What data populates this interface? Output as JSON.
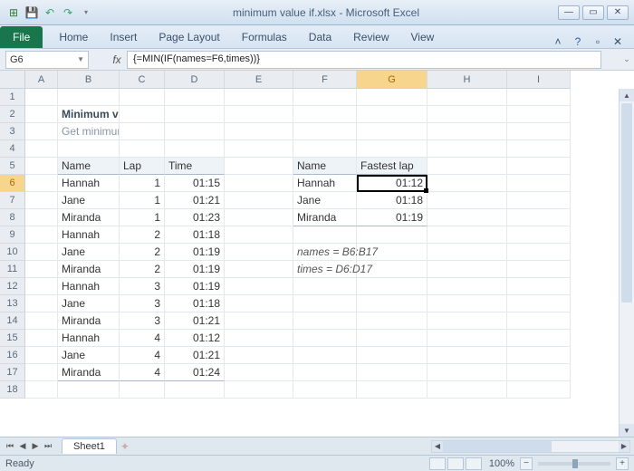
{
  "title": "minimum value if.xlsx  -  Microsoft Excel",
  "tabs": [
    "Home",
    "Insert",
    "Page Layout",
    "Formulas",
    "Data",
    "Review",
    "View"
  ],
  "file_label": "File",
  "namebox": "G6",
  "fx_label": "fx",
  "formula": "{=MIN(IF(names=F6,times))}",
  "columns": [
    "A",
    "B",
    "C",
    "D",
    "E",
    "F",
    "G",
    "H",
    "I"
  ],
  "content": {
    "title": "Minimum value if",
    "subtitle": "Get minimum if criteria matches",
    "table1_headers": [
      "Name",
      "Lap",
      "Time"
    ],
    "table1": [
      [
        "Hannah",
        "1",
        "01:15"
      ],
      [
        "Jane",
        "1",
        "01:21"
      ],
      [
        "Miranda",
        "1",
        "01:23"
      ],
      [
        "Hannah",
        "2",
        "01:18"
      ],
      [
        "Jane",
        "2",
        "01:19"
      ],
      [
        "Miranda",
        "2",
        "01:19"
      ],
      [
        "Hannah",
        "3",
        "01:19"
      ],
      [
        "Jane",
        "3",
        "01:18"
      ],
      [
        "Miranda",
        "3",
        "01:21"
      ],
      [
        "Hannah",
        "4",
        "01:12"
      ],
      [
        "Jane",
        "4",
        "01:21"
      ],
      [
        "Miranda",
        "4",
        "01:24"
      ]
    ],
    "table2_headers": [
      "Name",
      "Fastest lap"
    ],
    "table2": [
      [
        "Hannah",
        "01:12"
      ],
      [
        "Jane",
        "01:18"
      ],
      [
        "Miranda",
        "01:19"
      ]
    ],
    "note1": "names = B6:B17",
    "note2": "times = D6:D17"
  },
  "sheet_tab": "Sheet1",
  "status": "Ready",
  "zoom": "100%",
  "active": {
    "col": "G",
    "row": 6
  }
}
